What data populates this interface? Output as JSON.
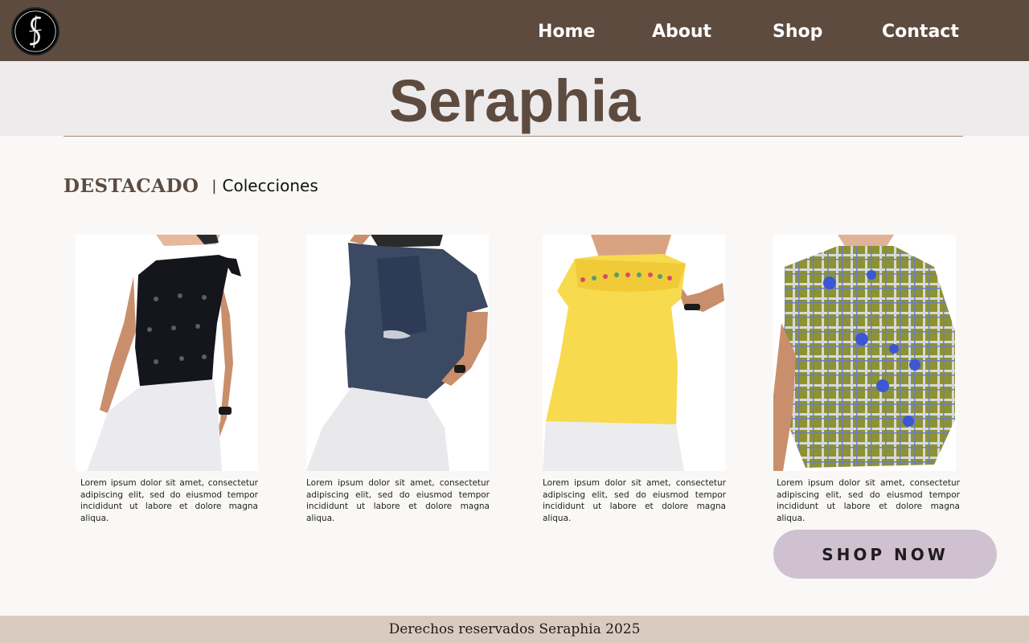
{
  "nav": {
    "logo_alt": "Seraphia logo",
    "links": [
      "Home",
      "About",
      "Shop",
      "Contact"
    ]
  },
  "hero": {
    "title": "Seraphia"
  },
  "section": {
    "main": "DESTACADO",
    "separator": "|",
    "sub": "Colecciones"
  },
  "products": [
    {
      "image": "black-one-shoulder-eyelet-top",
      "description": "Lorem ipsum dolor sit amet, consectetur adipiscing elit, sed do eiusmod tempor incididunt ut labore et dolore magna aliqua."
    },
    {
      "image": "denim-patchwork-top",
      "description": "Lorem ipsum dolor sit amet, consectetur adipiscing elit, sed do eiusmod tempor incididunt ut labore et dolore magna aliqua."
    },
    {
      "image": "yellow-embroidered-blouse",
      "description": "Lorem ipsum dolor sit amet, consectetur adipiscing elit, sed do eiusmod tempor incididunt ut labore et dolore magna aliqua."
    },
    {
      "image": "green-plaid-embroidered-top",
      "description": "Lorem ipsum dolor sit amet, consectetur adipiscing elit, sed do eiusmod tempor incididunt ut labore et dolore magna aliqua."
    }
  ],
  "cta": {
    "label": "SHOP NOW"
  },
  "footer": {
    "text": "Derechos reservados Seraphia 2025"
  },
  "colors": {
    "header_bg": "#5e4b40",
    "hero_bg": "#edebec",
    "page_bg": "#f9f8f6",
    "accent_brown": "#5e4b40",
    "cta_bg": "#cfc1d0",
    "footer_bg": "#d9cbc0"
  }
}
